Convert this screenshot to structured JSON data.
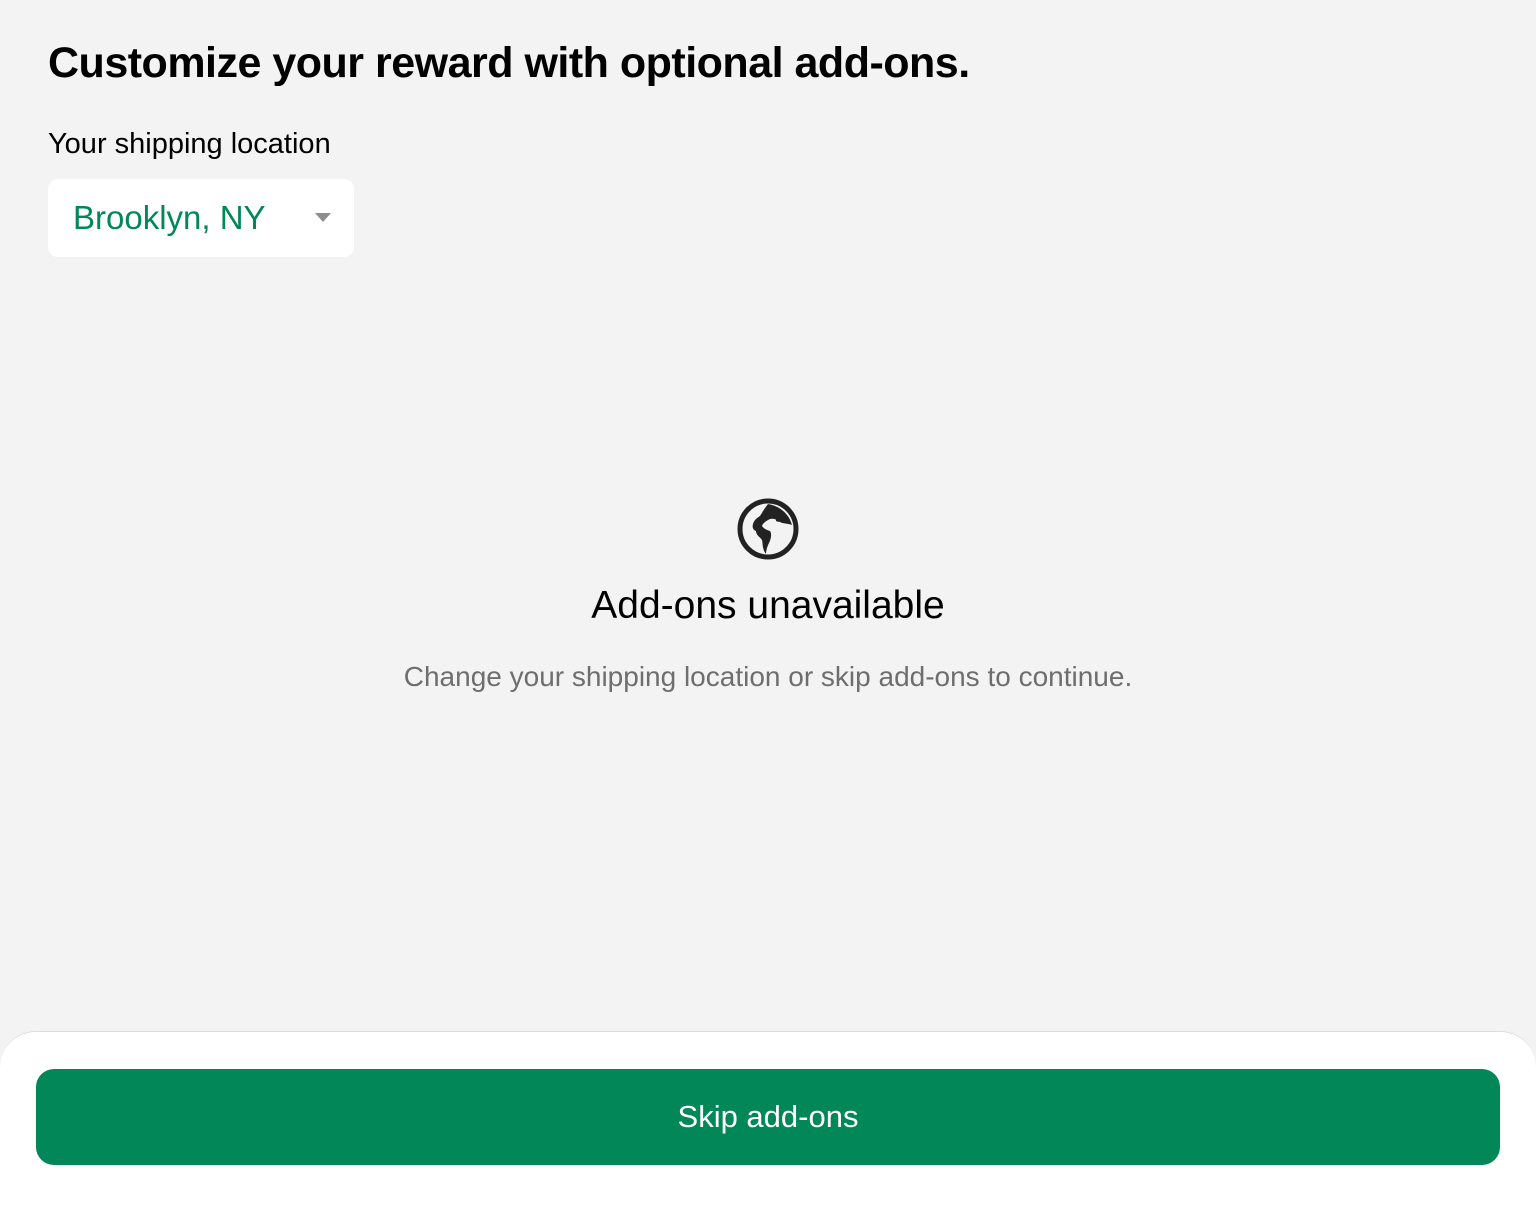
{
  "header": {
    "title": "Customize your reward with optional add-ons."
  },
  "shipping": {
    "label": "Your shipping location",
    "selected_location": "Brooklyn, NY",
    "icon": "chevron-down-icon"
  },
  "empty_state": {
    "icon": "globe-icon",
    "title": "Add-ons unavailable",
    "message": "Change your shipping location or skip add-ons to continue."
  },
  "footer": {
    "skip_label": "Skip add-ons"
  },
  "colors": {
    "accent": "#028858",
    "background": "#f3f3f3",
    "muted_text": "#6e6e6e"
  }
}
